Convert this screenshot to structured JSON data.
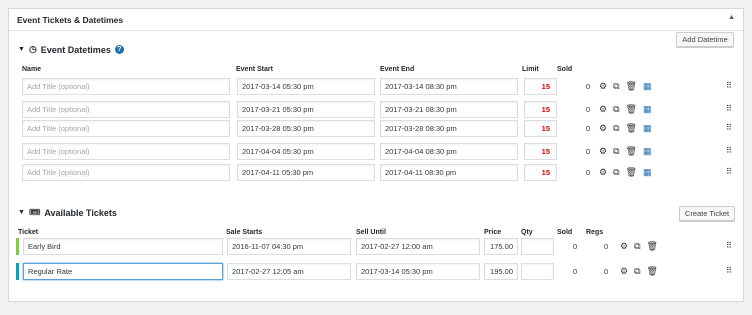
{
  "panel": {
    "title": "Event Tickets & Datetimes",
    "collapse_icon": "caret-up-icon"
  },
  "datetimes": {
    "title": "Event Datetimes",
    "add_button": "Add Datetime",
    "headers": {
      "name": "Name",
      "start": "Event Start",
      "end": "Event End",
      "limit": "Limit",
      "sold": "Sold"
    },
    "rows": [
      {
        "name_placeholder": "Add Title (optional)",
        "start": "2017-03-14 05:30 pm",
        "end": "2017-03-14 08:30 pm",
        "limit": "15",
        "sold": "0"
      },
      {
        "name_placeholder": "Add Title (optional)",
        "start": "2017-03-21 05:30 pm",
        "end": "2017-03-21 08:30 pm",
        "limit": "15",
        "sold": "0"
      },
      {
        "name_placeholder": "Add Title (optional)",
        "start": "2017-03-28 05:30 pm",
        "end": "2017-03-28 08:30 pm",
        "limit": "15",
        "sold": "0"
      },
      {
        "name_placeholder": "Add Title (optional)",
        "start": "2017-04-04 05:30 pm",
        "end": "2017-04-04 08:30 pm",
        "limit": "15",
        "sold": "0"
      },
      {
        "name_placeholder": "Add Title (optional)",
        "start": "2017-04-11 05:30 pm",
        "end": "2017-04-11 08:30 pm",
        "limit": "15",
        "sold": "0"
      }
    ]
  },
  "tickets": {
    "title": "Available Tickets",
    "create_button": "Create Ticket",
    "headers": {
      "ticket": "Ticket",
      "starts": "Sale Starts",
      "until": "Sell Until",
      "price": "Price",
      "qty": "Qty",
      "sold": "Sold",
      "regs": "Regs"
    },
    "rows": [
      {
        "name": "Early Bird",
        "starts": "2016-11-07 04:30 pm",
        "until": "2017-02-27 12:00 am",
        "price": "175.00",
        "qty": "",
        "sold": "0",
        "regs": "0",
        "status_color": "#7ad03a"
      },
      {
        "name": "Regular Rate",
        "starts": "2017-02-27 12:05 am",
        "until": "2017-03-14 05:30 pm",
        "price": "195.00",
        "qty": "",
        "sold": "0",
        "regs": "0",
        "status_color": "#00a0d2"
      }
    ]
  }
}
